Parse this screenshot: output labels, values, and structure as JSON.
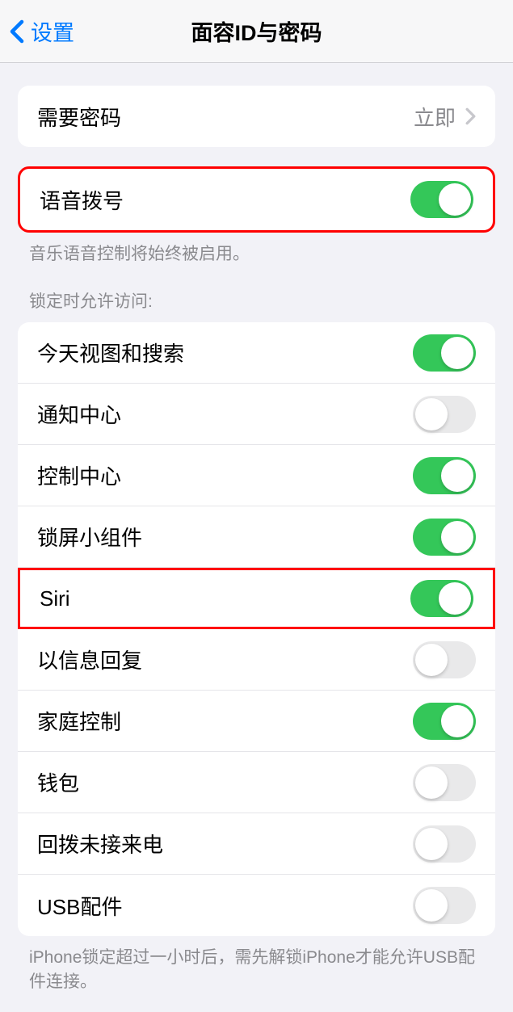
{
  "header": {
    "back_label": "设置",
    "title": "面容ID与密码"
  },
  "require_passcode": {
    "label": "需要密码",
    "value": "立即"
  },
  "voice_dial": {
    "label": "语音拨号",
    "enabled": true,
    "footer": "音乐语音控制将始终被启用。"
  },
  "lock_section": {
    "header": "锁定时允许访问:",
    "items": [
      {
        "label": "今天视图和搜索",
        "enabled": true
      },
      {
        "label": "通知中心",
        "enabled": false
      },
      {
        "label": "控制中心",
        "enabled": true
      },
      {
        "label": "锁屏小组件",
        "enabled": true
      },
      {
        "label": "Siri",
        "enabled": true
      },
      {
        "label": "以信息回复",
        "enabled": false
      },
      {
        "label": "家庭控制",
        "enabled": true
      },
      {
        "label": "钱包",
        "enabled": false
      },
      {
        "label": "回拨未接来电",
        "enabled": false
      },
      {
        "label": "USB配件",
        "enabled": false
      }
    ],
    "footer": "iPhone锁定超过一小时后，需先解锁iPhone才能允许USB配件连接。"
  }
}
